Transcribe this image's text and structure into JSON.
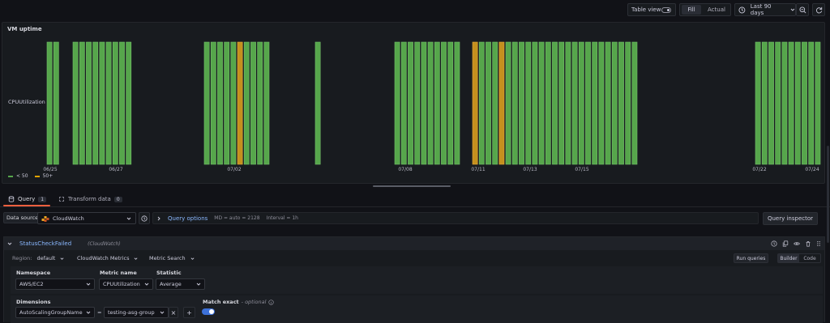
{
  "toolbar": {
    "table_view_label": "Table view",
    "fill_label": "Fill",
    "actual_label": "Actual",
    "time_range_label": "Last 90 days"
  },
  "panel": {
    "title": "VM uptime",
    "row_label": "CPUUtilization",
    "legend": [
      {
        "label": "< 50",
        "color": "#56a64b"
      },
      {
        "label": "50+",
        "color": "#e0a400"
      }
    ]
  },
  "chart_data": {
    "type": "bar",
    "title": "VM uptime",
    "row": "CPUUtilization",
    "x_tick_labels": [
      "06/25",
      "06/27",
      "07/02",
      "07/08",
      "07/11",
      "07/13",
      "07/15",
      "07/22",
      "07/24"
    ],
    "status_colors": {
      "normal": "#56a64b",
      "warn": "#c4901e"
    },
    "bar_groups": [
      {
        "count": 2,
        "warn": []
      },
      {
        "count": 9,
        "warn": []
      },
      {
        "count": 10,
        "warn": [
          5
        ]
      },
      {
        "count": 1,
        "warn": []
      },
      {
        "count": 10,
        "warn": []
      },
      {
        "count": 25,
        "warn": [
          0,
          4
        ]
      },
      {
        "count": 10,
        "warn": []
      }
    ]
  },
  "tabs": {
    "query_label": "Query",
    "query_count": "1",
    "transform_label": "Transform data",
    "transform_count": "0"
  },
  "datasource_bar": {
    "label": "Data source",
    "datasource": "CloudWatch",
    "query_options_label": "Query options",
    "md_info": "MD = auto = 2128",
    "interval_info": "Interval = 1h",
    "inspector_label": "Query inspector"
  },
  "query": {
    "name": "StatusCheckFailed",
    "datasource_note": "(CloudWatch)",
    "region_label": "Region:",
    "region_value": "default",
    "service_value": "CloudWatch Metrics",
    "search_value": "Metric Search",
    "run_label": "Run queries",
    "builder_label": "Builder",
    "code_label": "Code",
    "namespace_label": "Namespace",
    "namespace_value": "AWS/EC2",
    "metric_label": "Metric name",
    "metric_value": "CPUUtilization",
    "statistic_label": "Statistic",
    "statistic_value": "Average",
    "dimensions_label": "Dimensions",
    "dim_key": "AutoScalingGroupName",
    "dim_op": "=",
    "dim_value": "testing-asg-group",
    "match_label": "Match exact",
    "match_optional": "- optional",
    "add_label": "+",
    "remove_label": "×"
  }
}
